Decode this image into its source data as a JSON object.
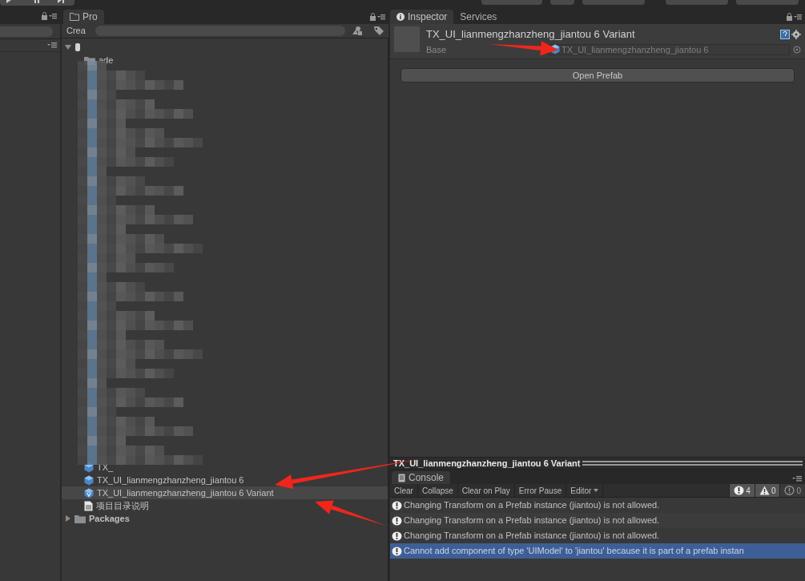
{
  "project": {
    "tab": "Pro",
    "create_button": "Crea",
    "tree": [
      {
        "expanded": true,
        "selected": false,
        "children": [
          {
            "label": "ade",
            "kind": "folder",
            "selected": false
          },
          {
            "label": "TX_",
            "kind": "prefab",
            "selected": false
          },
          {
            "label": "TX_UI_lianmengzhanzheng_jiantou 6",
            "kind": "prefab",
            "selected": false
          },
          {
            "label": "TX_UI_lianmengzhanzheng_jiantou 6 Variant",
            "kind": "variant",
            "selected": true
          },
          {
            "label": "项目目录说明",
            "kind": "text",
            "selected": false
          }
        ]
      },
      {
        "label": "Packages",
        "kind": "folder",
        "expanded": false,
        "selected": false
      }
    ]
  },
  "inspector": {
    "tabs": [
      {
        "label": "Inspector",
        "selected": true
      },
      {
        "label": "Services",
        "selected": false
      }
    ],
    "title": "TX_UI_lianmengzhanzheng_jiantou 6 Variant",
    "base_label": "Base",
    "base_value": "TX_UI_lianmengzhanzheng_jiantou 6",
    "open_button": "Open Prefab"
  },
  "preview_header": "TX_UI_lianmengzhanzheng_jiantou 6 Variant",
  "console": {
    "tab": "Console",
    "buttons": [
      {
        "label": "Clear",
        "kind": "button"
      },
      {
        "label": "Collapse",
        "kind": "button"
      },
      {
        "label": "Clear on Play",
        "kind": "button"
      },
      {
        "label": "Error Pause",
        "kind": "button"
      },
      {
        "label": "Editor",
        "kind": "dropdown"
      }
    ],
    "counters": [
      {
        "kind": "info",
        "count": "4",
        "on": true
      },
      {
        "kind": "warning",
        "count": "0",
        "on": true
      },
      {
        "kind": "error",
        "count": "0",
        "on": false
      }
    ],
    "messages": [
      {
        "text": "Changing Transform on a Prefab instance (jiantou) is not allowed.",
        "selected": false
      },
      {
        "text": "Changing Transform on a Prefab instance (jiantou) is not allowed.",
        "selected": false
      },
      {
        "text": "Changing Transform on a Prefab instance (jiantou) is not allowed.",
        "selected": false
      },
      {
        "text": "Cannot add component of type 'UIModel' to 'jiantou' because it is part of a prefab instan",
        "selected": true
      }
    ]
  }
}
